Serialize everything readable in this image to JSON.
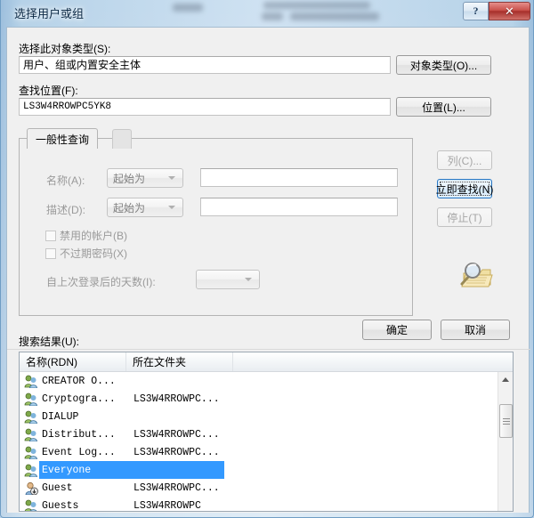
{
  "window": {
    "title": "选择用户或组",
    "help_button": "?",
    "close_button": "✕"
  },
  "form": {
    "object_type_label": "选择此对象类型(S):",
    "object_type_value": "用户、组或内置安全主体",
    "object_type_button": "对象类型(O)...",
    "location_label": "查找位置(F):",
    "location_value": "LS3W4RROWPC5YK8",
    "location_button": "位置(L)..."
  },
  "query": {
    "tab_label": "一般性查询",
    "name_label": "名称(A):",
    "name_condition": "起始为",
    "name_value": "",
    "description_label": "描述(D):",
    "description_condition": "起始为",
    "description_value": "",
    "disabled_accounts_label": "禁用的帐户(B)",
    "never_expire_label": "不过期密码(X)",
    "days_since_logon_label": "自上次登录后的天数(I):",
    "days_since_logon_value": ""
  },
  "side_buttons": {
    "columns": "列(C)...",
    "find_now": "立即查找(N)",
    "stop": "停止(T)"
  },
  "dialog_buttons": {
    "ok": "确定",
    "cancel": "取消"
  },
  "results": {
    "label": "搜索结果(U):",
    "columns": [
      "名称(RDN)",
      "所在文件夹",
      ""
    ],
    "rows": [
      {
        "icon": "group-icon",
        "name": "CREATOR O...",
        "folder": "",
        "selected": false
      },
      {
        "icon": "group-icon",
        "name": "Cryptogra...",
        "folder": "LS3W4RROWPC...",
        "selected": false
      },
      {
        "icon": "group-icon",
        "name": "DIALUP",
        "folder": "",
        "selected": false
      },
      {
        "icon": "group-icon",
        "name": "Distribut...",
        "folder": "LS3W4RROWPC...",
        "selected": false
      },
      {
        "icon": "group-icon",
        "name": "Event Log...",
        "folder": "LS3W4RROWPC...",
        "selected": false
      },
      {
        "icon": "group-icon",
        "name": "Everyone",
        "folder": "",
        "selected": true
      },
      {
        "icon": "user-icon",
        "name": "Guest",
        "folder": "LS3W4RROWPC...",
        "selected": false
      },
      {
        "icon": "group-icon",
        "name": "Guests",
        "folder": "LS3W4RROWPC",
        "selected": false
      }
    ]
  },
  "colors": {
    "selection": "#3399ff",
    "dialog_bg": "#f0f0f0",
    "glass": "#cfe2f2",
    "close_button": "#c9514b"
  }
}
